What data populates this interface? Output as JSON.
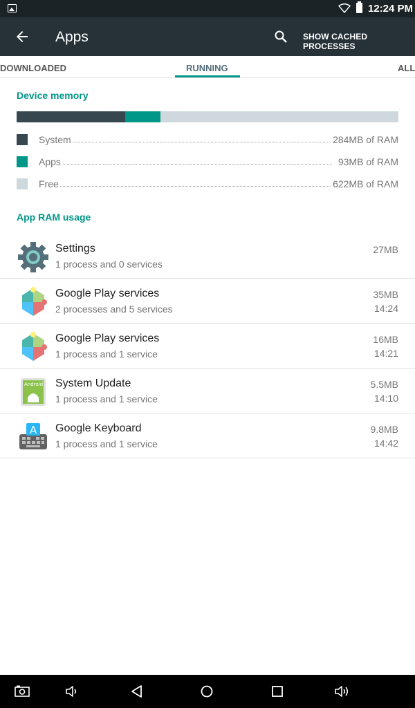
{
  "status_bar": {
    "time": "12:24 PM",
    "icons": [
      "image-notification-icon",
      "wifi-icon",
      "battery-icon"
    ]
  },
  "app_bar": {
    "title": "Apps",
    "back_icon": "arrow-back-icon",
    "search_icon": "search-icon",
    "action_label": "SHOW CACHED PROCESSES"
  },
  "tabs": [
    {
      "label": "DOWNLOADED",
      "selected": false
    },
    {
      "label": "RUNNING",
      "selected": true
    },
    {
      "label": "ALL",
      "selected": false
    }
  ],
  "device_memory": {
    "title": "Device memory",
    "legend": [
      {
        "label": "System",
        "value": "284MB of RAM",
        "color": "#37474f",
        "mb": 284
      },
      {
        "label": "Apps",
        "value": "93MB of RAM",
        "color": "#009688",
        "mb": 93
      },
      {
        "label": "Free",
        "value": "622MB of RAM",
        "color": "#cfd8dc",
        "mb": 622
      }
    ]
  },
  "app_ram": {
    "title": "App RAM usage",
    "apps": [
      {
        "name": "Settings",
        "detail": "1 process and 0 services",
        "size": "27MB",
        "time": "",
        "icon": "settings-gear-icon"
      },
      {
        "name": "Google Play services",
        "detail": "2 processes and 5 services",
        "size": "35MB",
        "time": "14:24",
        "icon": "google-play-services-icon"
      },
      {
        "name": "Google Play services",
        "detail": "1 process and 1 service",
        "size": "16MB",
        "time": "14:21",
        "icon": "google-play-services-icon"
      },
      {
        "name": "System Update",
        "detail": "1 process and 1 service",
        "size": "5.5MB",
        "time": "14:10",
        "icon": "system-update-android-icon",
        "icon_text": "Android"
      },
      {
        "name": "Google Keyboard",
        "detail": "1 process and 1 service",
        "size": "9.8MB",
        "time": "14:42",
        "icon": "google-keyboard-icon",
        "icon_text": "A"
      }
    ]
  },
  "nav_bar": {
    "icons": [
      "screenshot-icon",
      "volume-down-icon",
      "back-triangle-icon",
      "home-circle-icon",
      "recents-square-icon",
      "volume-up-icon"
    ]
  },
  "colors": {
    "accent": "#009688",
    "toolbar": "#263238",
    "status_bar": "#1c2326"
  }
}
